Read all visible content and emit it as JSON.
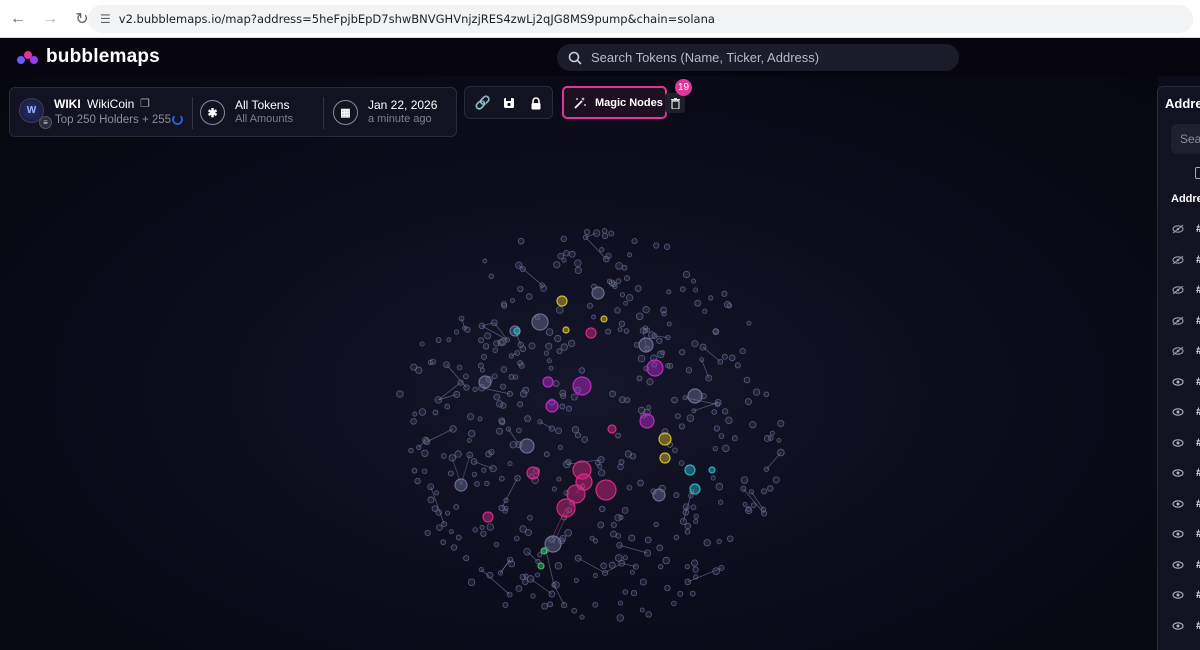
{
  "browser": {
    "url": "v2.bubblemaps.io/map?address=5heFpjbEpD7shwBNVGHVnjzjRES4zwLj2qJG8MS9pump&chain=solana",
    "back_icon": "arrow-left-icon",
    "forward_icon": "arrow-right-icon",
    "reload_icon": "reload-icon",
    "site_info_icon": "tune-icon"
  },
  "app": {
    "brand": "bubblemaps",
    "search_placeholder": "Search Tokens (Name, Ticker, Address)"
  },
  "token": {
    "symbol": "WIKI",
    "name": "WikiCoin",
    "holders_text": "Top 250 Holders + 255",
    "chain_icon": "solana-icon"
  },
  "filter": {
    "title": "All Tokens",
    "subtitle": "All Amounts"
  },
  "date": {
    "title": "Jan 22, 2026",
    "subtitle": "a minute ago"
  },
  "tools": [
    "link-icon",
    "save-icon",
    "lock-icon"
  ],
  "magic": {
    "label": "Magic Nodes",
    "count": "19"
  },
  "address_panel": {
    "title": "Addre",
    "search_placeholder": "Sea",
    "column_header": "Addre",
    "rows": [
      {
        "visibility": "hidden",
        "rank": "#"
      },
      {
        "visibility": "hidden",
        "rank": "#"
      },
      {
        "visibility": "hidden",
        "rank": "#"
      },
      {
        "visibility": "hidden",
        "rank": "#"
      },
      {
        "visibility": "hidden",
        "rank": "#"
      },
      {
        "visibility": "visible",
        "rank": "#"
      },
      {
        "visibility": "visible",
        "rank": "#"
      },
      {
        "visibility": "visible",
        "rank": "#"
      },
      {
        "visibility": "visible",
        "rank": "#"
      },
      {
        "visibility": "visible",
        "rank": "#"
      },
      {
        "visibility": "visible",
        "rank": "#"
      },
      {
        "visibility": "visible",
        "rank": "#"
      },
      {
        "visibility": "visible",
        "rank": "#"
      },
      {
        "visibility": "visible",
        "rank": "#"
      }
    ]
  },
  "colors": {
    "accent": "#e2349a",
    "magenta": "#c42ad0",
    "pink": "#e02a8a",
    "yellow": "#d7c22a",
    "cyan": "#2ab8c8",
    "green": "#39c86a",
    "node_default": "#6e7298"
  }
}
